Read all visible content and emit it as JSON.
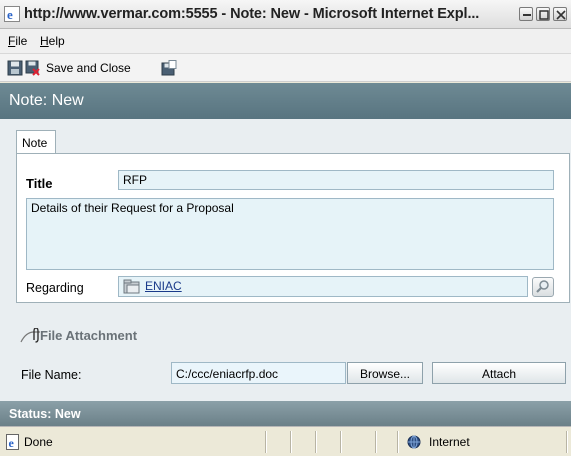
{
  "window": {
    "title": "http://www.vermar.com:5555 - Note: New - Microsoft Internet Expl..."
  },
  "menu": {
    "file_accel": "F",
    "file_rest": "ile",
    "help_accel": "H",
    "help_rest": "elp"
  },
  "toolbar": {
    "save_and_close_label": "Save and Close"
  },
  "form": {
    "header_title": "Note: New",
    "tab_label": "Note",
    "title_label": "Title",
    "title_value": "RFP",
    "body_value": "Details of their Request for a Proposal",
    "regarding_label": "Regarding",
    "regarding_value": "ENIAC"
  },
  "attachment": {
    "section_title": "File Attachment",
    "file_name_label": "File Name:",
    "file_name_value": "C:/ccc/eniacrfp.doc",
    "browse_label": "Browse...",
    "attach_label": "Attach"
  },
  "status": {
    "form_status": "Status: New",
    "browser_status": "Done",
    "zone": "Internet"
  },
  "icons": [
    "ie-icon",
    "minimize-icon",
    "maximize-icon",
    "close-icon",
    "save-icon",
    "save-and-close-icon",
    "save-and-new-icon",
    "record-icon",
    "lookup-icon",
    "paperclip-icon",
    "done-page-icon",
    "internet-globe-icon"
  ]
}
